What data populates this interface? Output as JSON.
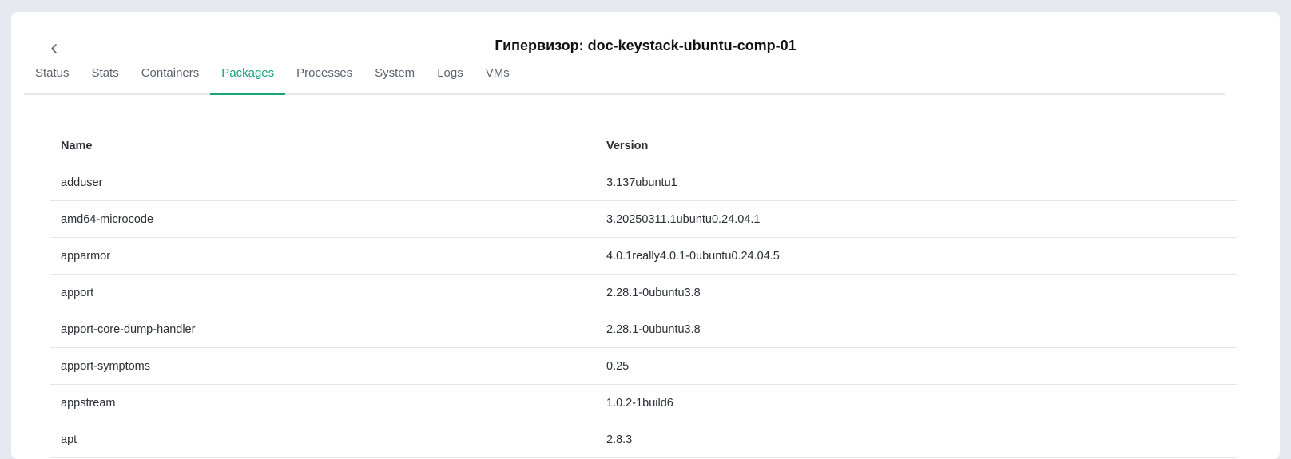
{
  "header": {
    "title": "Гипервизор: doc-keystack-ubuntu-comp-01"
  },
  "tabs": [
    {
      "label": "Status"
    },
    {
      "label": "Stats"
    },
    {
      "label": "Containers"
    },
    {
      "label": "Packages"
    },
    {
      "label": "Processes"
    },
    {
      "label": "System"
    },
    {
      "label": "Logs"
    },
    {
      "label": "VMs"
    }
  ],
  "active_tab": "Packages",
  "table": {
    "columns": {
      "name": "Name",
      "version": "Version"
    },
    "rows": [
      {
        "name": "adduser",
        "version": "3.137ubuntu1"
      },
      {
        "name": "amd64-microcode",
        "version": "3.20250311.1ubuntu0.24.04.1"
      },
      {
        "name": "apparmor",
        "version": "4.0.1really4.0.1-0ubuntu0.24.04.5"
      },
      {
        "name": "apport",
        "version": "2.28.1-0ubuntu3.8"
      },
      {
        "name": "apport-core-dump-handler",
        "version": "2.28.1-0ubuntu3.8"
      },
      {
        "name": "apport-symptoms",
        "version": "0.25"
      },
      {
        "name": "appstream",
        "version": "1.0.2-1build6"
      },
      {
        "name": "apt",
        "version": "2.8.3"
      }
    ]
  },
  "colors": {
    "accent": "#1aa37a",
    "background": "#e6eaf0",
    "panel": "#ffffff",
    "border": "#e3e6ea"
  }
}
